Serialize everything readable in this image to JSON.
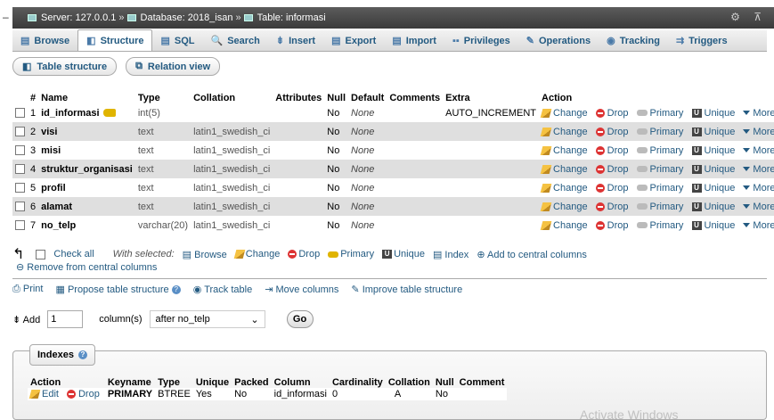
{
  "breadcrumb": {
    "dash": "–",
    "server": "Server: 127.0.0.1",
    "database": "Database: 2018_isan",
    "table": "Table: informasi",
    "sep": "»",
    "tools": "⚙ ⊼"
  },
  "tabs": [
    {
      "label": "Browse",
      "icon": "▤"
    },
    {
      "label": "Structure",
      "icon": "◧"
    },
    {
      "label": "SQL",
      "icon": "▤"
    },
    {
      "label": "Search",
      "icon": "🔍"
    },
    {
      "label": "Insert",
      "icon": "⇟"
    },
    {
      "label": "Export",
      "icon": "▤"
    },
    {
      "label": "Import",
      "icon": "▤"
    },
    {
      "label": "Privileges",
      "icon": "▪▪"
    },
    {
      "label": "Operations",
      "icon": "✎"
    },
    {
      "label": "Tracking",
      "icon": "◉"
    },
    {
      "label": "Triggers",
      "icon": "⇉"
    }
  ],
  "subtabs": [
    {
      "label": "Table structure",
      "icon": "◧"
    },
    {
      "label": "Relation view",
      "icon": "⧉"
    }
  ],
  "columns": [
    "#",
    "Name",
    "Type",
    "Collation",
    "Attributes",
    "Null",
    "Default",
    "Comments",
    "Extra",
    "Action"
  ],
  "rows": [
    {
      "num": "1",
      "name": "id_informasi",
      "type": "int(5)",
      "collation": "",
      "attributes": "",
      "null": "No",
      "default": "None",
      "comments": "",
      "extra": "AUTO_INCREMENT"
    },
    {
      "num": "2",
      "name": "visi",
      "type": "text",
      "collation": "latin1_swedish_ci",
      "attributes": "",
      "null": "No",
      "default": "None",
      "comments": "",
      "extra": ""
    },
    {
      "num": "3",
      "name": "misi",
      "type": "text",
      "collation": "latin1_swedish_ci",
      "attributes": "",
      "null": "No",
      "default": "None",
      "comments": "",
      "extra": ""
    },
    {
      "num": "4",
      "name": "struktur_organisasi",
      "type": "text",
      "collation": "latin1_swedish_ci",
      "attributes": "",
      "null": "No",
      "default": "None",
      "comments": "",
      "extra": ""
    },
    {
      "num": "5",
      "name": "profil",
      "type": "text",
      "collation": "latin1_swedish_ci",
      "attributes": "",
      "null": "No",
      "default": "None",
      "comments": "",
      "extra": ""
    },
    {
      "num": "6",
      "name": "alamat",
      "type": "text",
      "collation": "latin1_swedish_ci",
      "attributes": "",
      "null": "No",
      "default": "None",
      "comments": "",
      "extra": ""
    },
    {
      "num": "7",
      "name": "no_telp",
      "type": "varchar(20)",
      "collation": "latin1_swedish_ci",
      "attributes": "",
      "null": "No",
      "default": "None",
      "comments": "",
      "extra": ""
    }
  ],
  "row_actions": {
    "change": "Change",
    "drop": "Drop",
    "primary": "Primary",
    "unique": "Unique",
    "more": "More"
  },
  "with_selected": {
    "check_all": "Check all",
    "label": "With selected:",
    "browse": "Browse",
    "change": "Change",
    "drop": "Drop",
    "primary": "Primary",
    "unique": "Unique",
    "index": "Index",
    "add_central": "Add to central columns",
    "remove_central": "Remove from central columns"
  },
  "toolbar": {
    "print": "Print",
    "propose": "Propose table structure",
    "track": "Track table",
    "move": "Move columns",
    "improve": "Improve table structure"
  },
  "add_columns": {
    "label": "Add",
    "count": "1",
    "unit": "column(s)",
    "position": "after no_telp",
    "go": "Go"
  },
  "indexes": {
    "title": "Indexes",
    "columns": [
      "Action",
      "",
      "Keyname",
      "Type",
      "Unique",
      "Packed",
      "Column",
      "Cardinality",
      "Collation",
      "Null",
      "Comment"
    ],
    "row": {
      "edit": "Edit",
      "drop": "Drop",
      "keyname": "PRIMARY",
      "type": "BTREE",
      "unique": "Yes",
      "packed": "No",
      "column": "id_informasi",
      "cardinality": "0",
      "collation": "A",
      "null": "No",
      "comment": ""
    }
  },
  "watermark": "Activate Windows"
}
